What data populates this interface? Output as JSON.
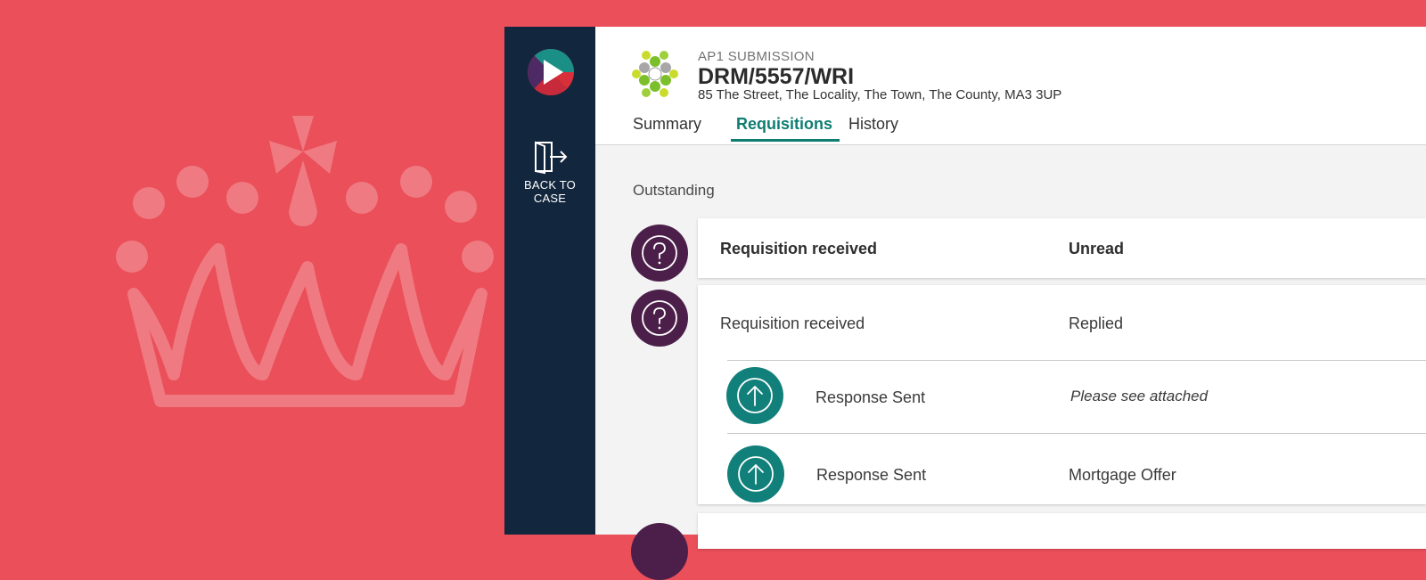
{
  "header": {
    "submission_label": "AP1 SUBMISSION",
    "reference": "DRM/5557/WRI",
    "address": "85 The Street, The Locality, The Town, The County, MA3 3UP"
  },
  "nav": {
    "back_label_line1": "BACK TO",
    "back_label_line2": "CASE"
  },
  "tabs": [
    {
      "label": "Summary",
      "active": false
    },
    {
      "label": "Requisitions",
      "active": true
    },
    {
      "label": "History",
      "active": false
    }
  ],
  "section": {
    "title": "Outstanding"
  },
  "requisitions": [
    {
      "title": "Requisition received",
      "status": "Unread"
    },
    {
      "title": "Requisition received",
      "status": "Replied",
      "responses": [
        {
          "title": "Response Sent",
          "detail": "Please see attached"
        },
        {
          "title": "Response Sent",
          "detail": "Mortgage Offer"
        }
      ]
    }
  ],
  "colors": {
    "background": "#ea4f5a",
    "nav": "#12263d",
    "accent": "#0f7d72",
    "question_circle": "#4b1f49",
    "response_circle": "#12807a"
  },
  "icons": {
    "background": "crown-watermark",
    "brand": "play-logo",
    "nav": "exit-door-icon",
    "case": "hexagon-cluster-logo",
    "requisition": "question-icon",
    "response": "arrow-up-icon"
  }
}
